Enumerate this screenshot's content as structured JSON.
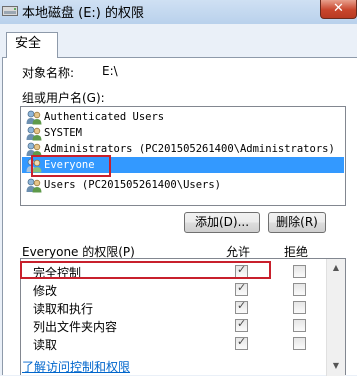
{
  "window": {
    "title": "本地磁盘 (E:) 的权限",
    "close_label": "✕"
  },
  "tab": {
    "label": "安全"
  },
  "object": {
    "label": "对象名称:",
    "value": "E:\\"
  },
  "group_label": "组或用户名(G):",
  "users": [
    {
      "name": "Authenticated Users",
      "selected": false
    },
    {
      "name": "SYSTEM",
      "selected": false
    },
    {
      "name": "Administrators (PC201505261400\\Administrators)",
      "selected": false
    },
    {
      "name": "Everyone",
      "selected": true
    },
    {
      "name": "Users (PC201505261400\\Users)",
      "selected": false
    }
  ],
  "buttons": {
    "add": "添加(D)...",
    "remove": "删除(R)"
  },
  "permissions": {
    "header": "Everyone 的权限(P)",
    "allow_label": "允许",
    "deny_label": "拒绝",
    "rows": [
      {
        "name": "完全控制",
        "allow": true,
        "deny": false
      },
      {
        "name": "修改",
        "allow": true,
        "deny": false
      },
      {
        "name": "读取和执行",
        "allow": true,
        "deny": false
      },
      {
        "name": "列出文件夹内容",
        "allow": true,
        "deny": false
      },
      {
        "name": "读取",
        "allow": true,
        "deny": false
      }
    ]
  },
  "link": "了解访问控制和权限",
  "colors": {
    "selection": "#3399ff",
    "highlight_box": "#c8202c",
    "link": "#0066cc"
  }
}
